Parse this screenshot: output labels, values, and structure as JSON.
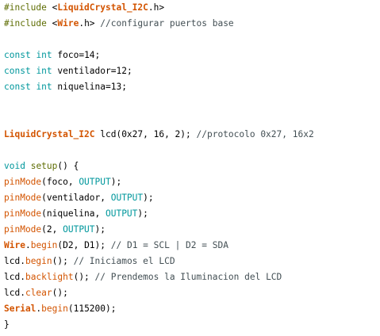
{
  "colors": {
    "background": "#ffffff",
    "preprocessor": "#5e6d03",
    "library_class": "#d35400",
    "keyword_type": "#00979c",
    "function": "#d35400",
    "constant": "#00979c",
    "comment": "#434f54",
    "plain": "#000000"
  },
  "code": {
    "lines": [
      {
        "tokens": [
          {
            "t": "#include ",
            "k": "pp"
          },
          {
            "t": "<",
            "k": "pl"
          },
          {
            "t": "LiquidCrystal_I2C",
            "k": "lib"
          },
          {
            "t": ".h>",
            "k": "pl"
          }
        ]
      },
      {
        "tokens": [
          {
            "t": "#include ",
            "k": "pp"
          },
          {
            "t": "<",
            "k": "pl"
          },
          {
            "t": "Wire",
            "k": "lib"
          },
          {
            "t": ".h> ",
            "k": "pl"
          },
          {
            "t": "//configurar puertos base",
            "k": "cmt"
          }
        ]
      },
      {
        "tokens": []
      },
      {
        "tokens": [
          {
            "t": "const",
            "k": "type"
          },
          {
            "t": " ",
            "k": "pl"
          },
          {
            "t": "int",
            "k": "type"
          },
          {
            "t": " foco=14;",
            "k": "pl"
          }
        ]
      },
      {
        "tokens": [
          {
            "t": "const",
            "k": "type"
          },
          {
            "t": " ",
            "k": "pl"
          },
          {
            "t": "int",
            "k": "type"
          },
          {
            "t": " ventilador=12;",
            "k": "pl"
          }
        ]
      },
      {
        "tokens": [
          {
            "t": "const",
            "k": "type"
          },
          {
            "t": " ",
            "k": "pl"
          },
          {
            "t": "int",
            "k": "type"
          },
          {
            "t": " niquelina=13;",
            "k": "pl"
          }
        ]
      },
      {
        "tokens": []
      },
      {
        "tokens": []
      },
      {
        "tokens": [
          {
            "t": "LiquidCrystal_I2C",
            "k": "lib"
          },
          {
            "t": " lcd(0x27, 16, 2); ",
            "k": "pl"
          },
          {
            "t": "//protocolo 0x27, 16x2",
            "k": "cmt"
          }
        ]
      },
      {
        "tokens": []
      },
      {
        "tokens": [
          {
            "t": "void",
            "k": "type"
          },
          {
            "t": " ",
            "k": "pl"
          },
          {
            "t": "setup",
            "k": "pp"
          },
          {
            "t": "() {",
            "k": "pl"
          }
        ]
      },
      {
        "tokens": [
          {
            "t": "pinMode",
            "k": "fn"
          },
          {
            "t": "(foco, ",
            "k": "pl"
          },
          {
            "t": "OUTPUT",
            "k": "cst"
          },
          {
            "t": ");",
            "k": "pl"
          }
        ]
      },
      {
        "tokens": [
          {
            "t": "pinMode",
            "k": "fn"
          },
          {
            "t": "(ventilador, ",
            "k": "pl"
          },
          {
            "t": "OUTPUT",
            "k": "cst"
          },
          {
            "t": ");",
            "k": "pl"
          }
        ]
      },
      {
        "tokens": [
          {
            "t": "pinMode",
            "k": "fn"
          },
          {
            "t": "(niquelina, ",
            "k": "pl"
          },
          {
            "t": "OUTPUT",
            "k": "cst"
          },
          {
            "t": ");",
            "k": "pl"
          }
        ]
      },
      {
        "tokens": [
          {
            "t": "pinMode",
            "k": "fn"
          },
          {
            "t": "(2, ",
            "k": "pl"
          },
          {
            "t": "OUTPUT",
            "k": "cst"
          },
          {
            "t": ");",
            "k": "pl"
          }
        ]
      },
      {
        "tokens": [
          {
            "t": "Wire",
            "k": "lib"
          },
          {
            "t": ".",
            "k": "pl"
          },
          {
            "t": "begin",
            "k": "fn"
          },
          {
            "t": "(D2, D1); ",
            "k": "pl"
          },
          {
            "t": "// D1 = SCL | D2 = SDA",
            "k": "cmt"
          }
        ]
      },
      {
        "tokens": [
          {
            "t": "lcd.",
            "k": "pl"
          },
          {
            "t": "begin",
            "k": "fn"
          },
          {
            "t": "(); ",
            "k": "pl"
          },
          {
            "t": "// Iniciamos el LCD",
            "k": "cmt"
          }
        ]
      },
      {
        "tokens": [
          {
            "t": "lcd.",
            "k": "pl"
          },
          {
            "t": "backlight",
            "k": "fn"
          },
          {
            "t": "(); ",
            "k": "pl"
          },
          {
            "t": "// Prendemos la Iluminacion del LCD",
            "k": "cmt"
          }
        ]
      },
      {
        "tokens": [
          {
            "t": "lcd.",
            "k": "pl"
          },
          {
            "t": "clear",
            "k": "fn"
          },
          {
            "t": "();",
            "k": "pl"
          }
        ]
      },
      {
        "tokens": [
          {
            "t": "Serial",
            "k": "lib"
          },
          {
            "t": ".",
            "k": "pl"
          },
          {
            "t": "begin",
            "k": "fn"
          },
          {
            "t": "(115200);",
            "k": "pl"
          }
        ]
      },
      {
        "tokens": [
          {
            "t": "}",
            "k": "pl"
          }
        ]
      }
    ]
  }
}
